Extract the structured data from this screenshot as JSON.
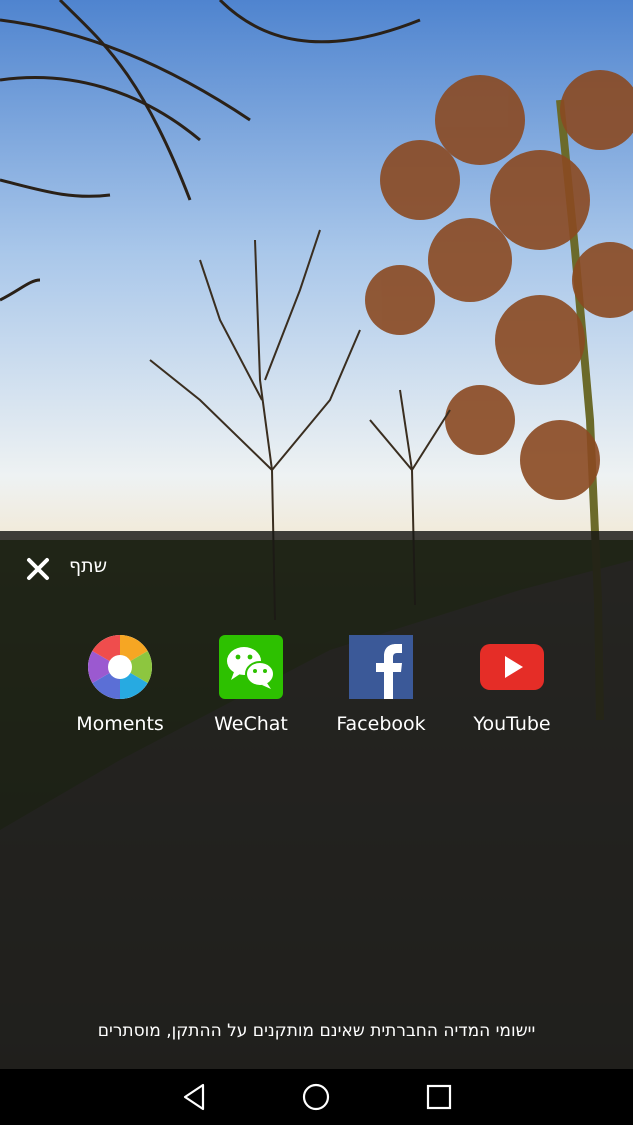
{
  "share": {
    "title": "שתף",
    "close_icon": "close-icon"
  },
  "apps": [
    {
      "label": "Moments",
      "icon": "moments-icon"
    },
    {
      "label": "WeChat",
      "icon": "wechat-icon"
    },
    {
      "label": "Facebook",
      "icon": "facebook-icon"
    },
    {
      "label": "YouTube",
      "icon": "youtube-icon"
    }
  ],
  "footer": {
    "note": "יישומי המדיה החברתית שאינם מותקנים על ההתקן, מוסתרים"
  },
  "navbar": {
    "back_icon": "back-triangle-icon",
    "home_icon": "home-circle-icon",
    "recents_icon": "recents-square-icon"
  },
  "colors": {
    "sheet_overlay": "#161614",
    "wechat_green": "#2dc100",
    "facebook_blue": "#3b5998",
    "youtube_red": "#e52d27"
  }
}
